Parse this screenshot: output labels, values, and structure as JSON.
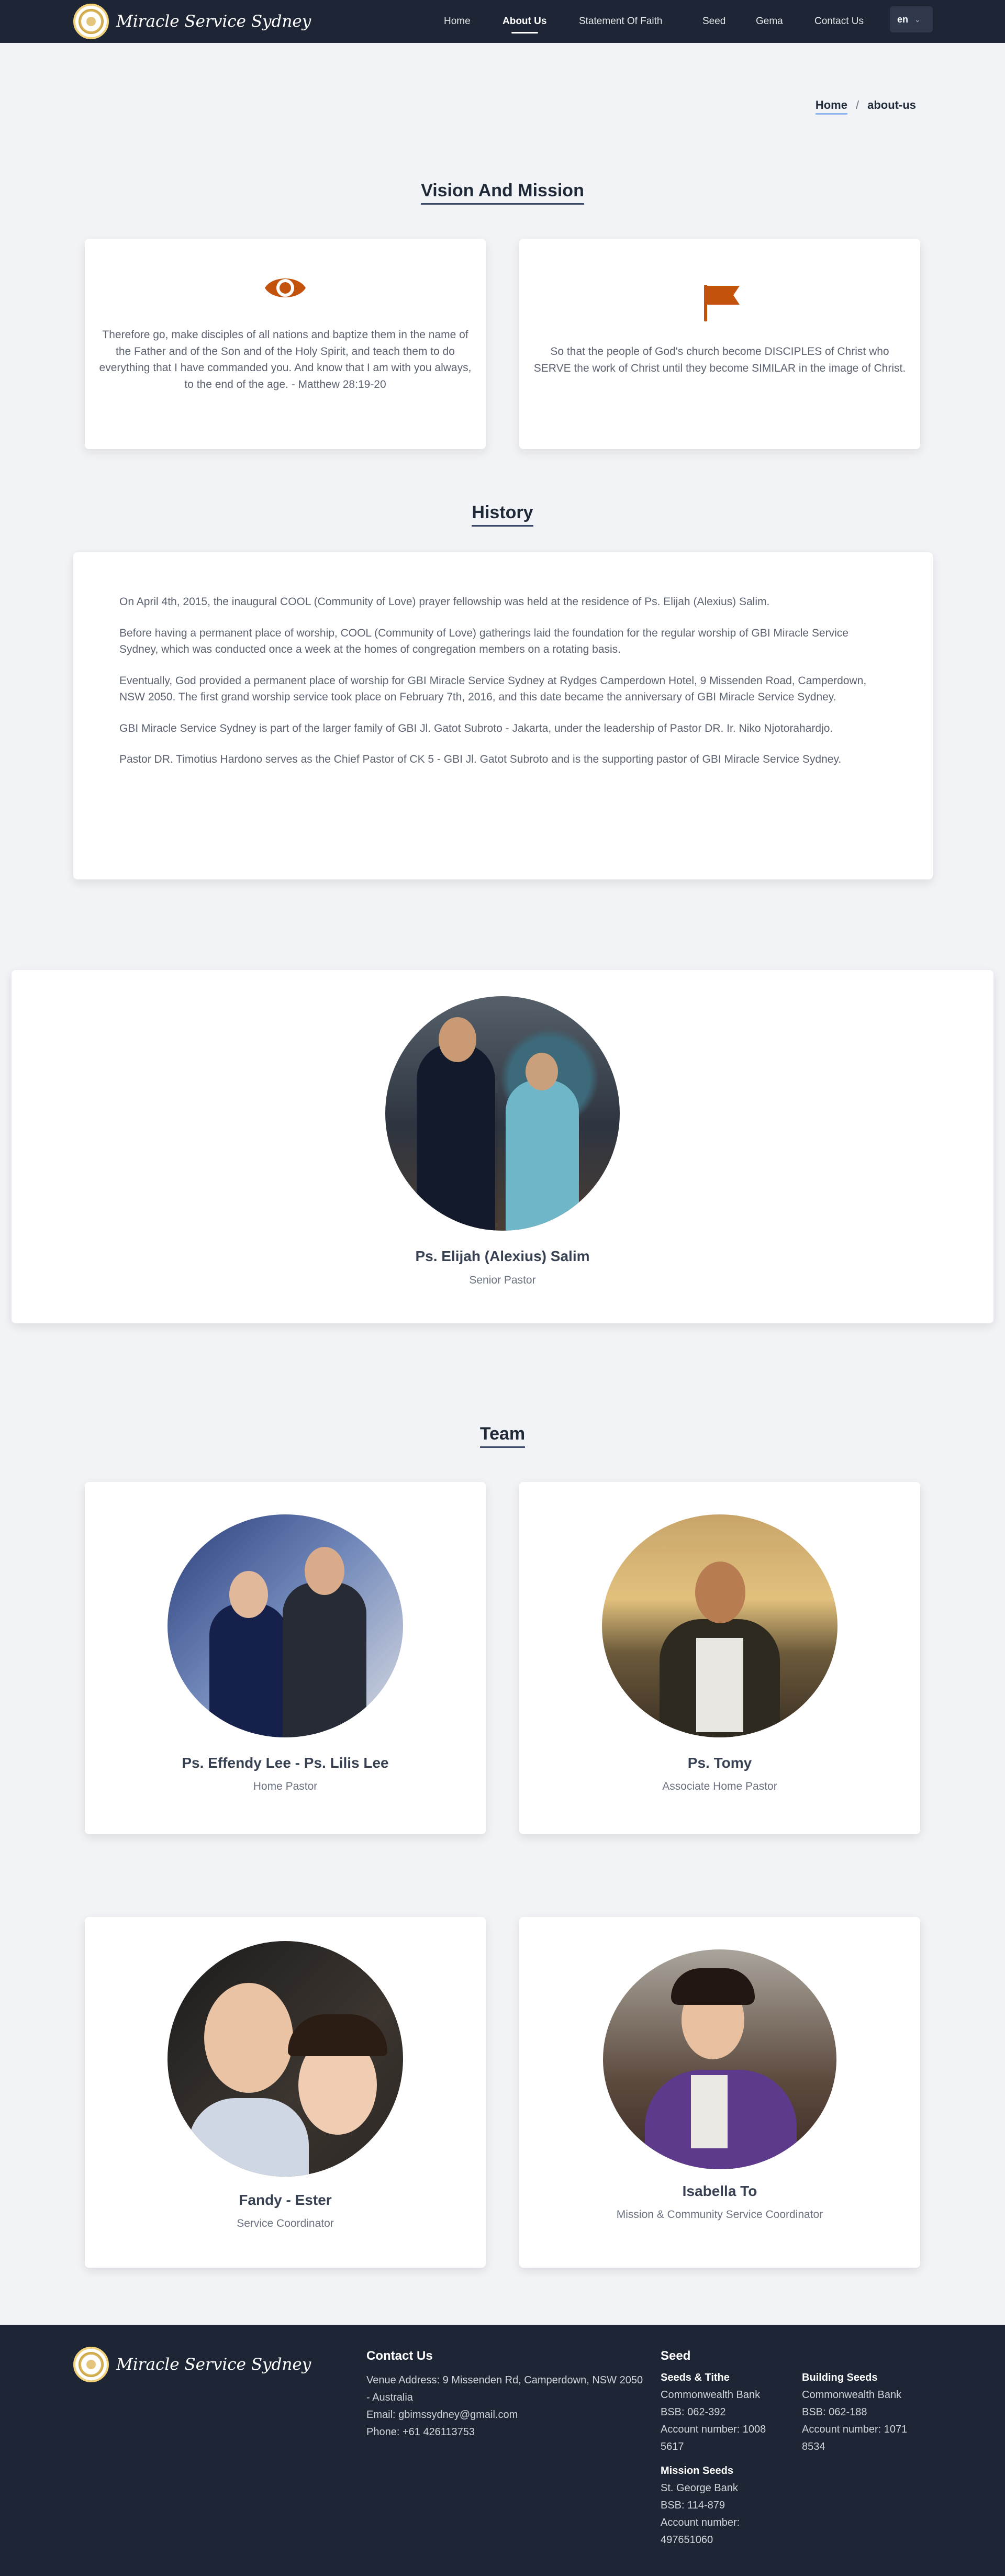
{
  "brand": {
    "name": "Miracle Service Sydney"
  },
  "nav": {
    "items": [
      "Home",
      "About Us",
      "Statement Of Faith",
      "Seed",
      "Gema",
      "Contact Us"
    ],
    "active": "About Us",
    "lang": "en"
  },
  "breadcrumb": {
    "home": "Home",
    "sep": "/",
    "current": "about-us"
  },
  "vision": {
    "title": "Vision And Mission",
    "vision_text": "Therefore go, make disciples of all nations and baptize them in the name of the Father and of the Son and of the Holy Spirit, and teach them to do everything that I have commanded you. And know that I am with you always, to the end of the age. - Matthew 28:19-20",
    "mission_text": "So that the people of God's church become DISCIPLES of Christ who SERVE the work of Christ until they become SIMILAR in the image of Christ.",
    "icon_color": "#c2520c",
    "icons": [
      "eye-icon",
      "flag-icon"
    ]
  },
  "history": {
    "title": "History",
    "paragraphs": [
      "On April 4th, 2015, the inaugural COOL (Community of Love) prayer fellowship was held at the residence of Ps. Elijah (Alexius) Salim.",
      "Before having a permanent place of worship, COOL (Community of Love) gatherings laid the foundation for the regular worship of GBI Miracle Service Sydney, which was conducted once a week at the homes of congregation members on a rotating basis.",
      "Eventually, God provided a permanent place of worship for GBI Miracle Service Sydney at Rydges Camperdown Hotel, 9 Missenden Road, Camperdown, NSW 2050. The first grand worship service took place on February 7th, 2016, and this date became the anniversary of GBI Miracle Service Sydney.",
      "GBI Miracle Service Sydney is part of the larger family of GBI Jl. Gatot Subroto - Jakarta, under the leadership of Pastor DR. Ir. Niko Njotorahardjo.",
      "Pastor DR. Timotius Hardono serves as the Chief Pastor of CK 5 - GBI Jl. Gatot Subroto and is the supporting pastor of GBI Miracle Service Sydney."
    ]
  },
  "senior": {
    "name": "Ps. Elijah (Alexius) Salim",
    "role": "Senior Pastor"
  },
  "team": {
    "title": "Team",
    "members": [
      {
        "name": "Ps. Effendy Lee - Ps. Lilis Lee",
        "role": "Home Pastor"
      },
      {
        "name": "Ps. Tomy",
        "role": "Associate Home Pastor"
      },
      {
        "name": "Fandy - Ester",
        "role": "Service Coordinator"
      },
      {
        "name": "Isabella To",
        "role": "Mission & Community Service Coordinator"
      }
    ]
  },
  "footer": {
    "contact": {
      "title": "Contact Us",
      "address": "Venue Address: 9 Missenden Rd, Camperdown, NSW 2050 - Australia",
      "email": "Email: gbimssydney@gmail.com",
      "phone": "Phone: +61 426113753"
    },
    "seed": {
      "title": "Seed",
      "tithe": {
        "title": "Seeds & Tithe",
        "bank": "Commonwealth Bank",
        "bsb": "BSB: 062-392",
        "account": "Account number: 1008 5617"
      },
      "building": {
        "title": "Building Seeds",
        "bank": "Commonwealth Bank",
        "bsb": "BSB: 062-188",
        "account": "Account number: 1071 8534"
      },
      "mission": {
        "title": "Mission Seeds",
        "bank": "St. George Bank",
        "bsb": "BSB: 114-879",
        "account": "Account number: 497651060"
      }
    }
  }
}
